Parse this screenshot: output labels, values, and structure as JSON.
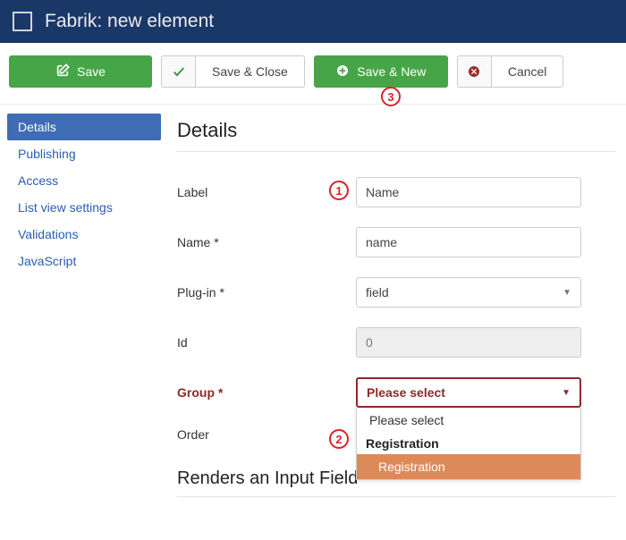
{
  "header": {
    "title": "Fabrik: new element"
  },
  "toolbar": {
    "save": "Save",
    "save_close": "Save & Close",
    "save_new": "Save & New",
    "cancel": "Cancel"
  },
  "sidebar": {
    "items": [
      {
        "label": "Details",
        "active": true
      },
      {
        "label": "Publishing",
        "active": false
      },
      {
        "label": "Access",
        "active": false
      },
      {
        "label": "List view settings",
        "active": false
      },
      {
        "label": "Validations",
        "active": false
      },
      {
        "label": "JavaScript",
        "active": false
      }
    ]
  },
  "main": {
    "heading": "Details",
    "fields": {
      "label": {
        "label": "Label",
        "value": "Name"
      },
      "name": {
        "label": "Name *",
        "value": "name"
      },
      "plugin": {
        "label": "Plug-in *",
        "value": "field"
      },
      "id": {
        "label": "Id",
        "value": "0"
      },
      "group": {
        "label": "Group *",
        "value": "Please select",
        "options_flat": [
          "Please select"
        ],
        "optgroup": "Registration",
        "options_grouped": [
          "Registration"
        ]
      },
      "order": {
        "label": "Order"
      }
    },
    "subheading": "Renders an Input Field"
  },
  "annotations": {
    "a1": "1",
    "a2": "2",
    "a3": "3"
  }
}
